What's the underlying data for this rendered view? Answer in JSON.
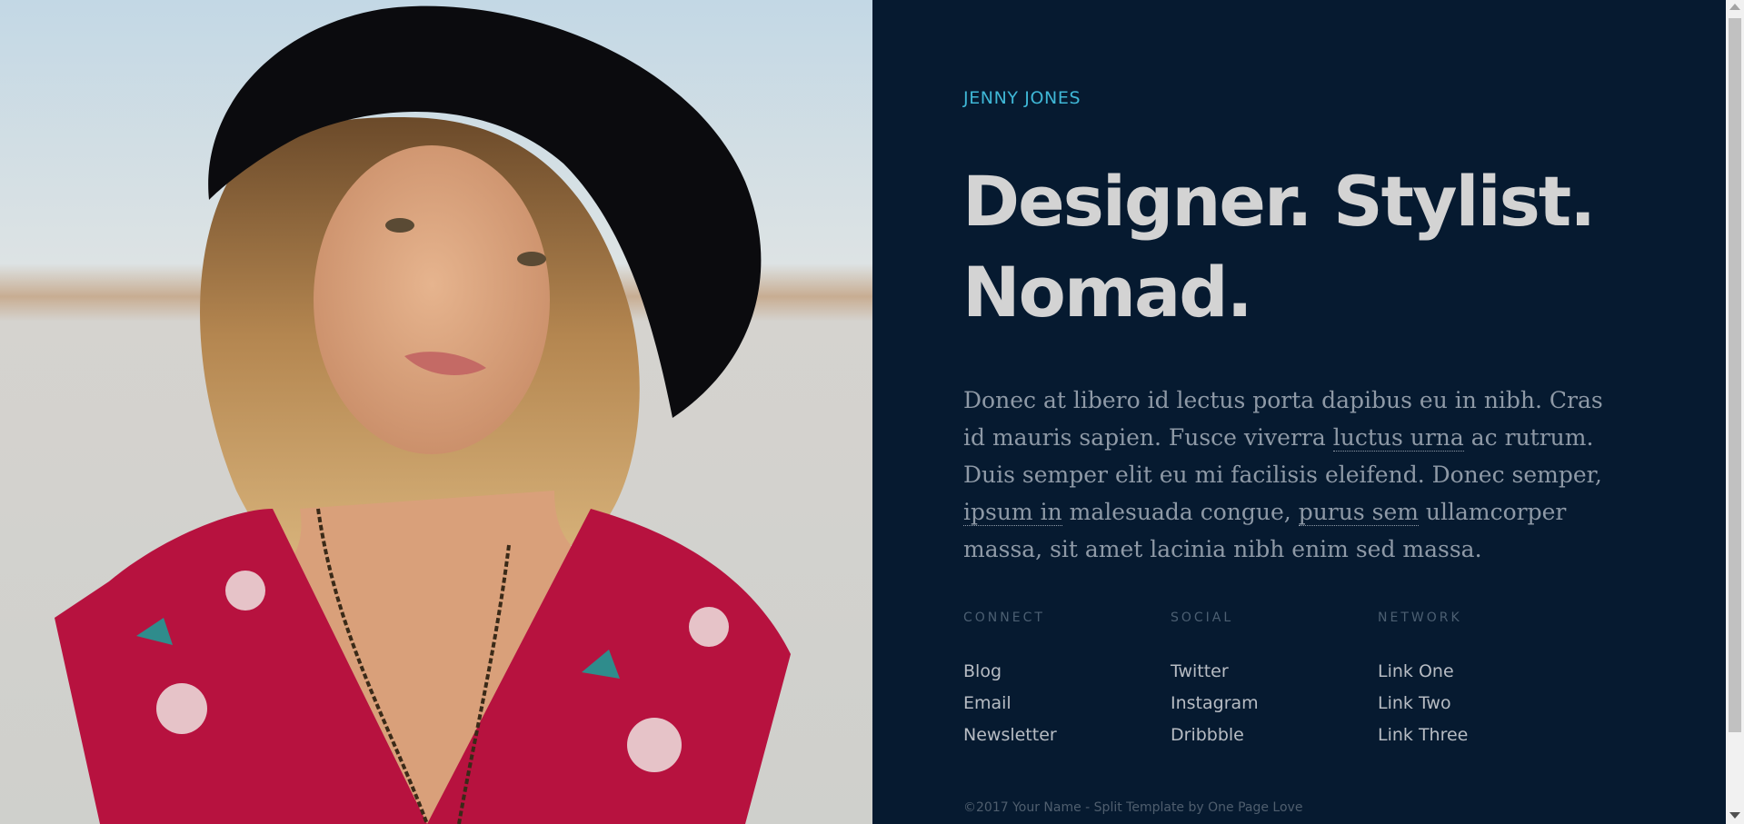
{
  "photo": {
    "subject": "portrait-photo"
  },
  "brand": {
    "name": "JENNY JONES"
  },
  "hero": {
    "line1": "Designer. Stylist.",
    "line2": "Nomad."
  },
  "intro": {
    "part1": "Donec at libero id lectus porta dapibus eu in nibh. Cras id mauris sapien. Fusce viverra ",
    "link1": "luctus urna",
    "part2": " ac rutrum. Duis semper elit eu mi facilisis eleifend. Donec semper, ",
    "link2": "ipsum in",
    "part3": " malesuada congue, ",
    "link3": "purus sem",
    "part4": " ullamcorper massa, sit amet lacinia nibh enim sed massa."
  },
  "columns": {
    "connect": {
      "heading": "CONNECT",
      "links": [
        "Blog",
        "Email",
        "Newsletter"
      ]
    },
    "social": {
      "heading": "SOCIAL",
      "links": [
        "Twitter",
        "Instagram",
        "Dribbble"
      ]
    },
    "network": {
      "heading": "NETWORK",
      "links": [
        "Link One",
        "Link Two",
        "Link Three"
      ]
    }
  },
  "footer": {
    "text": "©2017 Your Name - Split Template by One Page Love"
  },
  "colors": {
    "background": "#061a30",
    "accent": "#3fb7d6",
    "headline": "#d3d3d3",
    "body_text": "#8e99a6"
  }
}
